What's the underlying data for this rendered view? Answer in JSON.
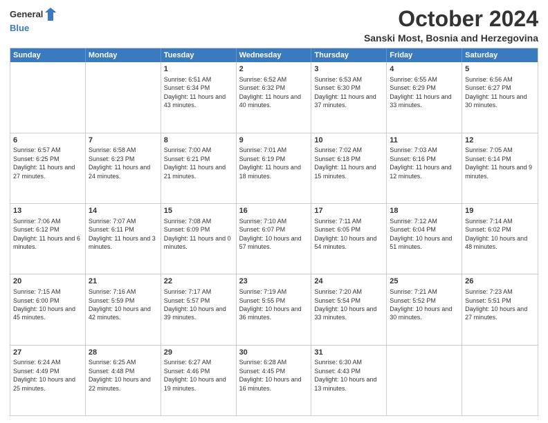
{
  "logo": {
    "general": "General",
    "blue": "Blue"
  },
  "title": "October 2024",
  "location": "Sanski Most, Bosnia and Herzegovina",
  "days": [
    "Sunday",
    "Monday",
    "Tuesday",
    "Wednesday",
    "Thursday",
    "Friday",
    "Saturday"
  ],
  "weeks": [
    [
      {
        "day": "",
        "sunrise": "",
        "sunset": "",
        "daylight": ""
      },
      {
        "day": "",
        "sunrise": "",
        "sunset": "",
        "daylight": ""
      },
      {
        "day": "1",
        "sunrise": "Sunrise: 6:51 AM",
        "sunset": "Sunset: 6:34 PM",
        "daylight": "Daylight: 11 hours and 43 minutes."
      },
      {
        "day": "2",
        "sunrise": "Sunrise: 6:52 AM",
        "sunset": "Sunset: 6:32 PM",
        "daylight": "Daylight: 11 hours and 40 minutes."
      },
      {
        "day": "3",
        "sunrise": "Sunrise: 6:53 AM",
        "sunset": "Sunset: 6:30 PM",
        "daylight": "Daylight: 11 hours and 37 minutes."
      },
      {
        "day": "4",
        "sunrise": "Sunrise: 6:55 AM",
        "sunset": "Sunset: 6:29 PM",
        "daylight": "Daylight: 11 hours and 33 minutes."
      },
      {
        "day": "5",
        "sunrise": "Sunrise: 6:56 AM",
        "sunset": "Sunset: 6:27 PM",
        "daylight": "Daylight: 11 hours and 30 minutes."
      }
    ],
    [
      {
        "day": "6",
        "sunrise": "Sunrise: 6:57 AM",
        "sunset": "Sunset: 6:25 PM",
        "daylight": "Daylight: 11 hours and 27 minutes."
      },
      {
        "day": "7",
        "sunrise": "Sunrise: 6:58 AM",
        "sunset": "Sunset: 6:23 PM",
        "daylight": "Daylight: 11 hours and 24 minutes."
      },
      {
        "day": "8",
        "sunrise": "Sunrise: 7:00 AM",
        "sunset": "Sunset: 6:21 PM",
        "daylight": "Daylight: 11 hours and 21 minutes."
      },
      {
        "day": "9",
        "sunrise": "Sunrise: 7:01 AM",
        "sunset": "Sunset: 6:19 PM",
        "daylight": "Daylight: 11 hours and 18 minutes."
      },
      {
        "day": "10",
        "sunrise": "Sunrise: 7:02 AM",
        "sunset": "Sunset: 6:18 PM",
        "daylight": "Daylight: 11 hours and 15 minutes."
      },
      {
        "day": "11",
        "sunrise": "Sunrise: 7:03 AM",
        "sunset": "Sunset: 6:16 PM",
        "daylight": "Daylight: 11 hours and 12 minutes."
      },
      {
        "day": "12",
        "sunrise": "Sunrise: 7:05 AM",
        "sunset": "Sunset: 6:14 PM",
        "daylight": "Daylight: 11 hours and 9 minutes."
      }
    ],
    [
      {
        "day": "13",
        "sunrise": "Sunrise: 7:06 AM",
        "sunset": "Sunset: 6:12 PM",
        "daylight": "Daylight: 11 hours and 6 minutes."
      },
      {
        "day": "14",
        "sunrise": "Sunrise: 7:07 AM",
        "sunset": "Sunset: 6:11 PM",
        "daylight": "Daylight: 11 hours and 3 minutes."
      },
      {
        "day": "15",
        "sunrise": "Sunrise: 7:08 AM",
        "sunset": "Sunset: 6:09 PM",
        "daylight": "Daylight: 11 hours and 0 minutes."
      },
      {
        "day": "16",
        "sunrise": "Sunrise: 7:10 AM",
        "sunset": "Sunset: 6:07 PM",
        "daylight": "Daylight: 10 hours and 57 minutes."
      },
      {
        "day": "17",
        "sunrise": "Sunrise: 7:11 AM",
        "sunset": "Sunset: 6:05 PM",
        "daylight": "Daylight: 10 hours and 54 minutes."
      },
      {
        "day": "18",
        "sunrise": "Sunrise: 7:12 AM",
        "sunset": "Sunset: 6:04 PM",
        "daylight": "Daylight: 10 hours and 51 minutes."
      },
      {
        "day": "19",
        "sunrise": "Sunrise: 7:14 AM",
        "sunset": "Sunset: 6:02 PM",
        "daylight": "Daylight: 10 hours and 48 minutes."
      }
    ],
    [
      {
        "day": "20",
        "sunrise": "Sunrise: 7:15 AM",
        "sunset": "Sunset: 6:00 PM",
        "daylight": "Daylight: 10 hours and 45 minutes."
      },
      {
        "day": "21",
        "sunrise": "Sunrise: 7:16 AM",
        "sunset": "Sunset: 5:59 PM",
        "daylight": "Daylight: 10 hours and 42 minutes."
      },
      {
        "day": "22",
        "sunrise": "Sunrise: 7:17 AM",
        "sunset": "Sunset: 5:57 PM",
        "daylight": "Daylight: 10 hours and 39 minutes."
      },
      {
        "day": "23",
        "sunrise": "Sunrise: 7:19 AM",
        "sunset": "Sunset: 5:55 PM",
        "daylight": "Daylight: 10 hours and 36 minutes."
      },
      {
        "day": "24",
        "sunrise": "Sunrise: 7:20 AM",
        "sunset": "Sunset: 5:54 PM",
        "daylight": "Daylight: 10 hours and 33 minutes."
      },
      {
        "day": "25",
        "sunrise": "Sunrise: 7:21 AM",
        "sunset": "Sunset: 5:52 PM",
        "daylight": "Daylight: 10 hours and 30 minutes."
      },
      {
        "day": "26",
        "sunrise": "Sunrise: 7:23 AM",
        "sunset": "Sunset: 5:51 PM",
        "daylight": "Daylight: 10 hours and 27 minutes."
      }
    ],
    [
      {
        "day": "27",
        "sunrise": "Sunrise: 6:24 AM",
        "sunset": "Sunset: 4:49 PM",
        "daylight": "Daylight: 10 hours and 25 minutes."
      },
      {
        "day": "28",
        "sunrise": "Sunrise: 6:25 AM",
        "sunset": "Sunset: 4:48 PM",
        "daylight": "Daylight: 10 hours and 22 minutes."
      },
      {
        "day": "29",
        "sunrise": "Sunrise: 6:27 AM",
        "sunset": "Sunset: 4:46 PM",
        "daylight": "Daylight: 10 hours and 19 minutes."
      },
      {
        "day": "30",
        "sunrise": "Sunrise: 6:28 AM",
        "sunset": "Sunset: 4:45 PM",
        "daylight": "Daylight: 10 hours and 16 minutes."
      },
      {
        "day": "31",
        "sunrise": "Sunrise: 6:30 AM",
        "sunset": "Sunset: 4:43 PM",
        "daylight": "Daylight: 10 hours and 13 minutes."
      },
      {
        "day": "",
        "sunrise": "",
        "sunset": "",
        "daylight": ""
      },
      {
        "day": "",
        "sunrise": "",
        "sunset": "",
        "daylight": ""
      }
    ]
  ]
}
